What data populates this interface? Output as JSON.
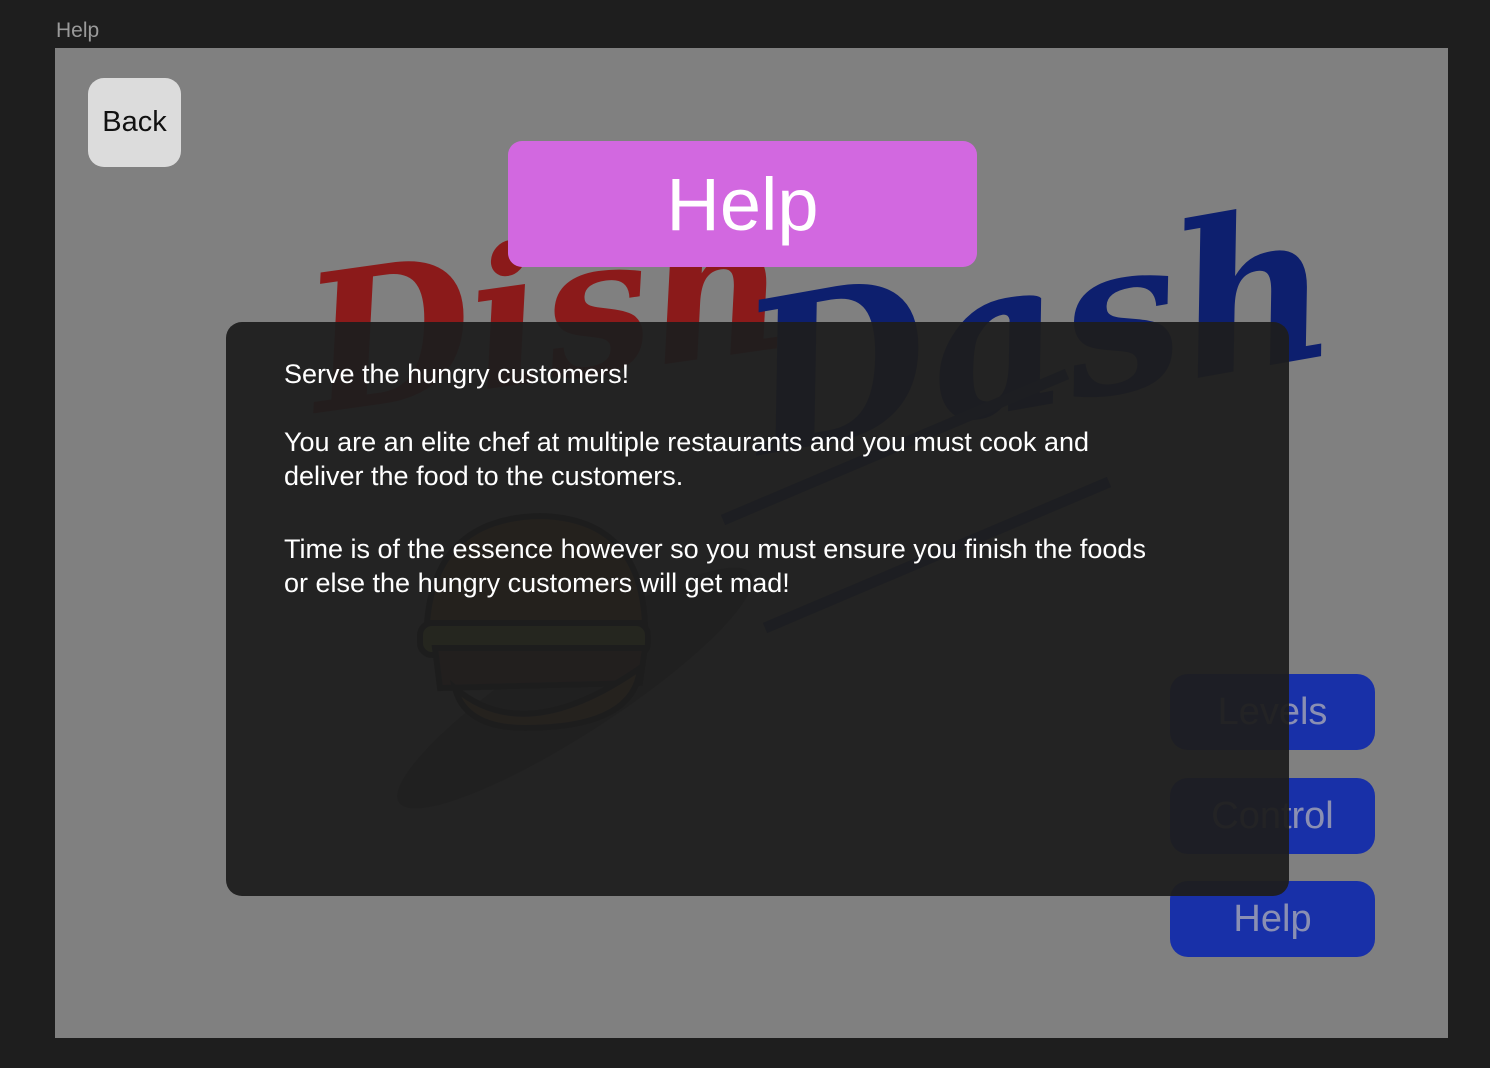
{
  "frame": {
    "label": "Help"
  },
  "back_button": {
    "label": "Back"
  },
  "title_banner": {
    "label": "Help"
  },
  "logo": {
    "word1": "Dish",
    "word2": "Dash",
    "icon": "burger-icon"
  },
  "help_text": {
    "line1": "Serve the hungry customers!",
    "paragraph2_line1": "You are an elite chef at multiple restaurants and you must cook and",
    "paragraph2_line2": "deliver the  food to the customers.",
    "paragraph3_line1": "Time is of the essence however so you must ensure you finish the foods",
    "paragraph3_line2": "or else the hungry customers will get mad!"
  },
  "menu": {
    "levels": "Levels",
    "control": "Control",
    "help": "Help"
  },
  "colors": {
    "background": "#1e1e1e",
    "frame": "#808080",
    "banner": "#d268e0",
    "menu_button": "#1830a8",
    "logo_red": "#8b1a1a",
    "logo_blue": "#0d1f6e"
  }
}
